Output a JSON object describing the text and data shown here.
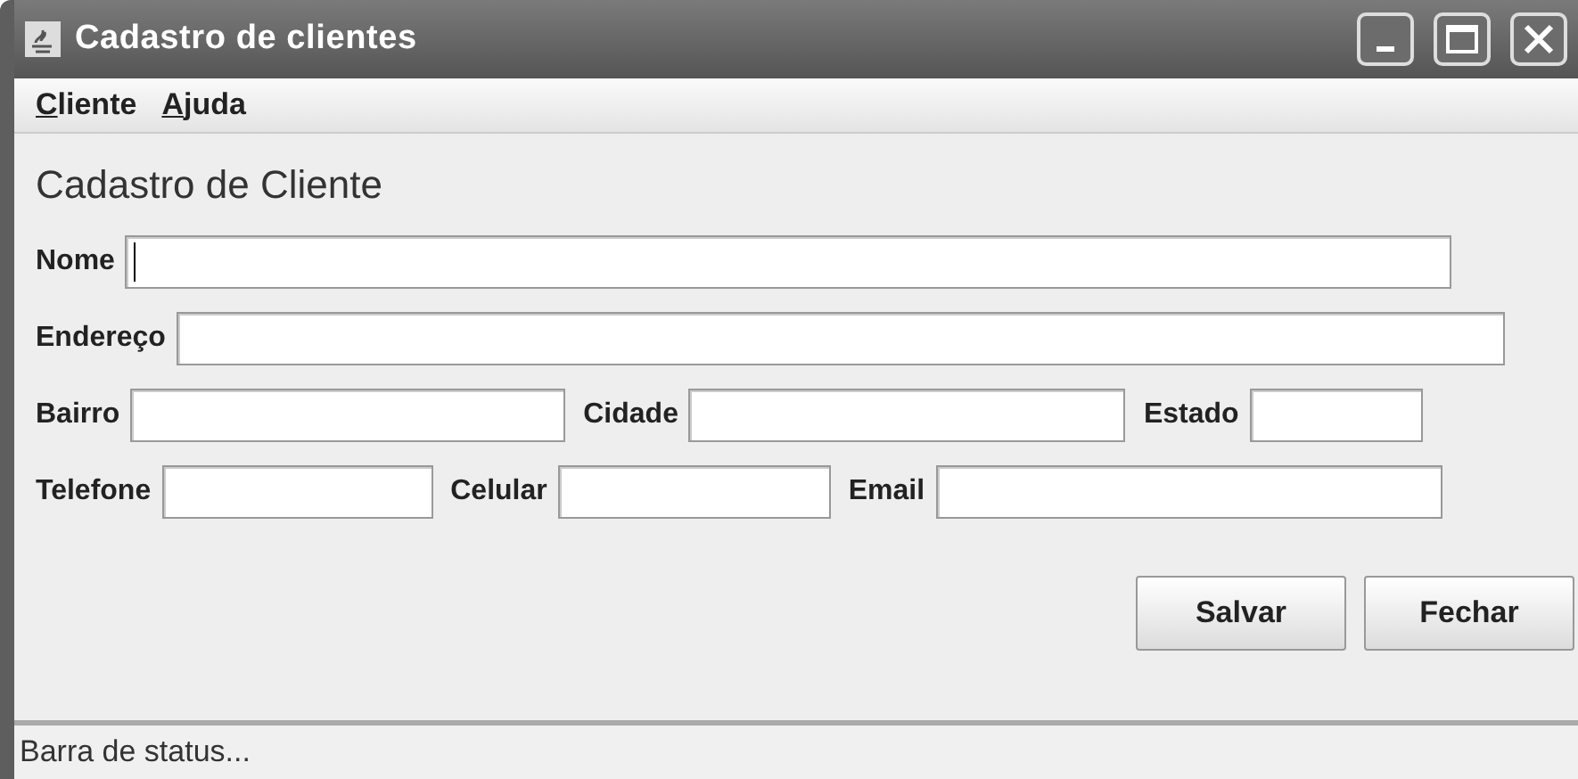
{
  "window": {
    "title": "Cadastro de clientes",
    "controls": [
      {
        "kind": "minimize"
      },
      {
        "kind": "maximize"
      },
      {
        "kind": "close"
      }
    ]
  },
  "menu": [
    {
      "label": "Cliente"
    },
    {
      "label": "Ajuda"
    }
  ],
  "heading": "Cadastro de Cliente",
  "rows": [
    [
      {
        "label": "Nome",
        "focused": true
      }
    ],
    [
      {
        "label": "Endereço",
        "focused": false
      }
    ],
    [
      {
        "label": "Bairro",
        "focused": false
      },
      {
        "label": "Cidade",
        "focused": false
      },
      {
        "label": "Estado",
        "focused": false
      }
    ],
    [
      {
        "label": "Telefone",
        "focused": false
      },
      {
        "label": "Celular",
        "focused": false
      },
      {
        "label": "Email",
        "focused": false
      }
    ]
  ],
  "buttons": [
    "Salvar",
    "Fechar"
  ],
  "status_bar": "Barra de status..."
}
